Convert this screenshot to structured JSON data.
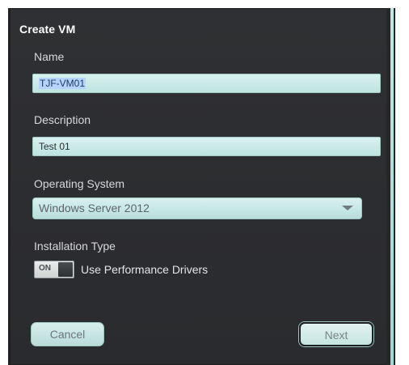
{
  "dialog": {
    "title": "Create VM"
  },
  "form": {
    "name_label": "Name",
    "name_value": "TJF-VM01",
    "description_label": "Description",
    "description_value": "Test 01",
    "os_label": "Operating System",
    "os_value": "Windows Server 2012",
    "install_type_label": "Installation Type",
    "toggle_state": "ON",
    "toggle_label": "Use Performance Drivers"
  },
  "buttons": {
    "cancel_label": "Cancel",
    "next_label": "Next"
  },
  "icons": {
    "dropdown": "chevron-down-icon"
  },
  "colors": {
    "background": "#2e2f32",
    "field": "#c9e9e6",
    "accent_rail": "#bfe9e4",
    "text": "#d6d8da"
  }
}
